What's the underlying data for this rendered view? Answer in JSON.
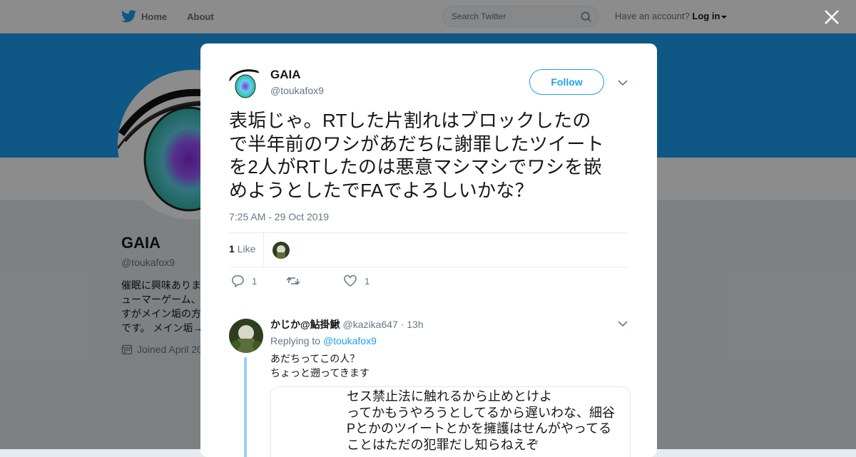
{
  "topbar": {
    "home_label": "Home",
    "about_label": "About",
    "search_placeholder": "Search Twitter",
    "have_account": "Have an account?",
    "login_label": "Log in"
  },
  "profile_bg": {
    "name": "GAIA",
    "handle": "@toukafox9",
    "bio_lines": [
      "催眠に興味ありま",
      "ューマーゲーム、",
      "すがメイン垢の方",
      "です。 メイン垢→"
    ],
    "joined": "Joined April 20"
  },
  "tweet": {
    "author_name": "GAIA",
    "author_handle": "@toukafox9",
    "follow_label": "Follow",
    "text_lines": [
      "表垢じゃ。RTした片割れはブロックしたの",
      "で半年前のワシがあだちに謝罪したツイート",
      "を2人がRTしたのは悪意マシマシでワシを嵌",
      "めようとしたでFAでよろしいかな？"
    ],
    "timestamp": "7:25 AM - 29 Oct 2019",
    "like_count": "1",
    "like_label": "Like",
    "reply_count": "1",
    "favorite_count": "1"
  },
  "reply": {
    "name": "かじか@鮎掛鰍",
    "handle": "@kazika647",
    "separator": "·",
    "time": "13h",
    "replying_prefix": "Replying to",
    "replying_to": "@toukafox9",
    "text_lines": [
      "あだちってこの人？",
      "ちょっと遡ってきます"
    ],
    "quote_lines": [
      "セス禁止法に触れるから止めとけよ",
      "ってかもうやろうとしてるから遅いわな、細谷",
      "Pとかのツイートとかを擁護はせんがやってる",
      "ことはただの犯罪だし知らねえぞ"
    ]
  },
  "colors": {
    "brand": "#1da1f2",
    "text": "#14171a",
    "muted": "#657786",
    "thread_line": "#9ad0f5"
  },
  "icons": [
    "twitter-bird-icon",
    "home-icon",
    "search-icon",
    "close-icon",
    "chevron-down-icon",
    "reply-icon",
    "retweet-icon",
    "heart-icon",
    "calendar-icon"
  ]
}
